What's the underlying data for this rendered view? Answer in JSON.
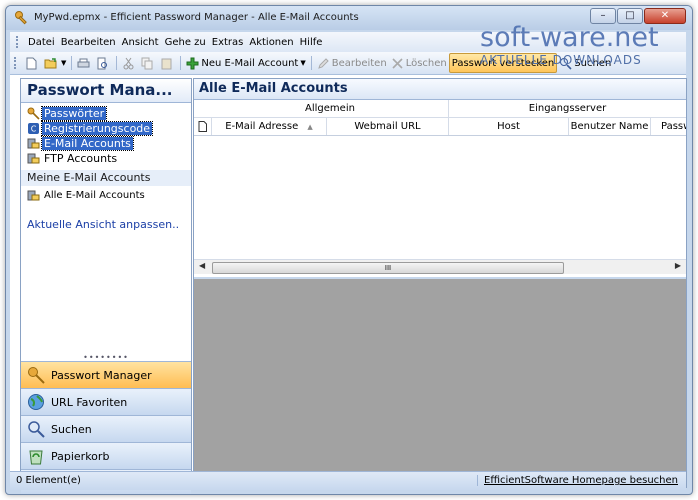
{
  "window": {
    "title": "MyPwd.epmx - Efficient Password Manager - Alle E-Mail Accounts",
    "controls": {
      "minimize": "–",
      "maximize": "□",
      "close": "✕"
    }
  },
  "menu": [
    "Datei",
    "Bearbeiten",
    "Ansicht",
    "Gehe zu",
    "Extras",
    "Aktionen",
    "Hilfe"
  ],
  "toolbar": {
    "new_account": "Neu E-Mail Account",
    "edit": "Bearbeiten",
    "delete": "Löschen",
    "hide_password": "Passwort verstecken",
    "search": "Suchen"
  },
  "sidebar": {
    "title": "Passwort Mana...",
    "items": [
      {
        "label": "Passwörter"
      },
      {
        "label": "Registrierungscode"
      },
      {
        "label": "E-Mail Accounts"
      },
      {
        "label": "FTP Accounts"
      }
    ],
    "group_label": "Meine E-Mail Accounts",
    "group_item": "Alle E-Mail Accounts",
    "customize_link": "Aktuelle Ansicht anpassen..",
    "splitter": "••••••••",
    "nav": [
      {
        "label": "Passwort Manager"
      },
      {
        "label": "URL Favoriten"
      },
      {
        "label": "Suchen"
      },
      {
        "label": "Papierkorb"
      }
    ],
    "nav_more": "»"
  },
  "content": {
    "title": "Alle E-Mail Accounts",
    "group_headers": [
      "Allgemein",
      "Eingangsserver"
    ],
    "columns": [
      "E-Mail Adresse",
      "Webmail URL",
      "Host",
      "Benutzer Name",
      "Passw"
    ],
    "scroll_grip": "III",
    "scroll_left": "◀",
    "scroll_right": "▶"
  },
  "status": {
    "left": "0 Element(e)",
    "right": "EfficientSoftware Homepage besuchen"
  },
  "watermark": {
    "main": "soft-ware.net",
    "sub": "AKTUELLE DOWNLOADS"
  },
  "colors": {
    "accent": "#3268c8",
    "highlight": "#ffc55a",
    "frame": "#c6d7ec"
  }
}
